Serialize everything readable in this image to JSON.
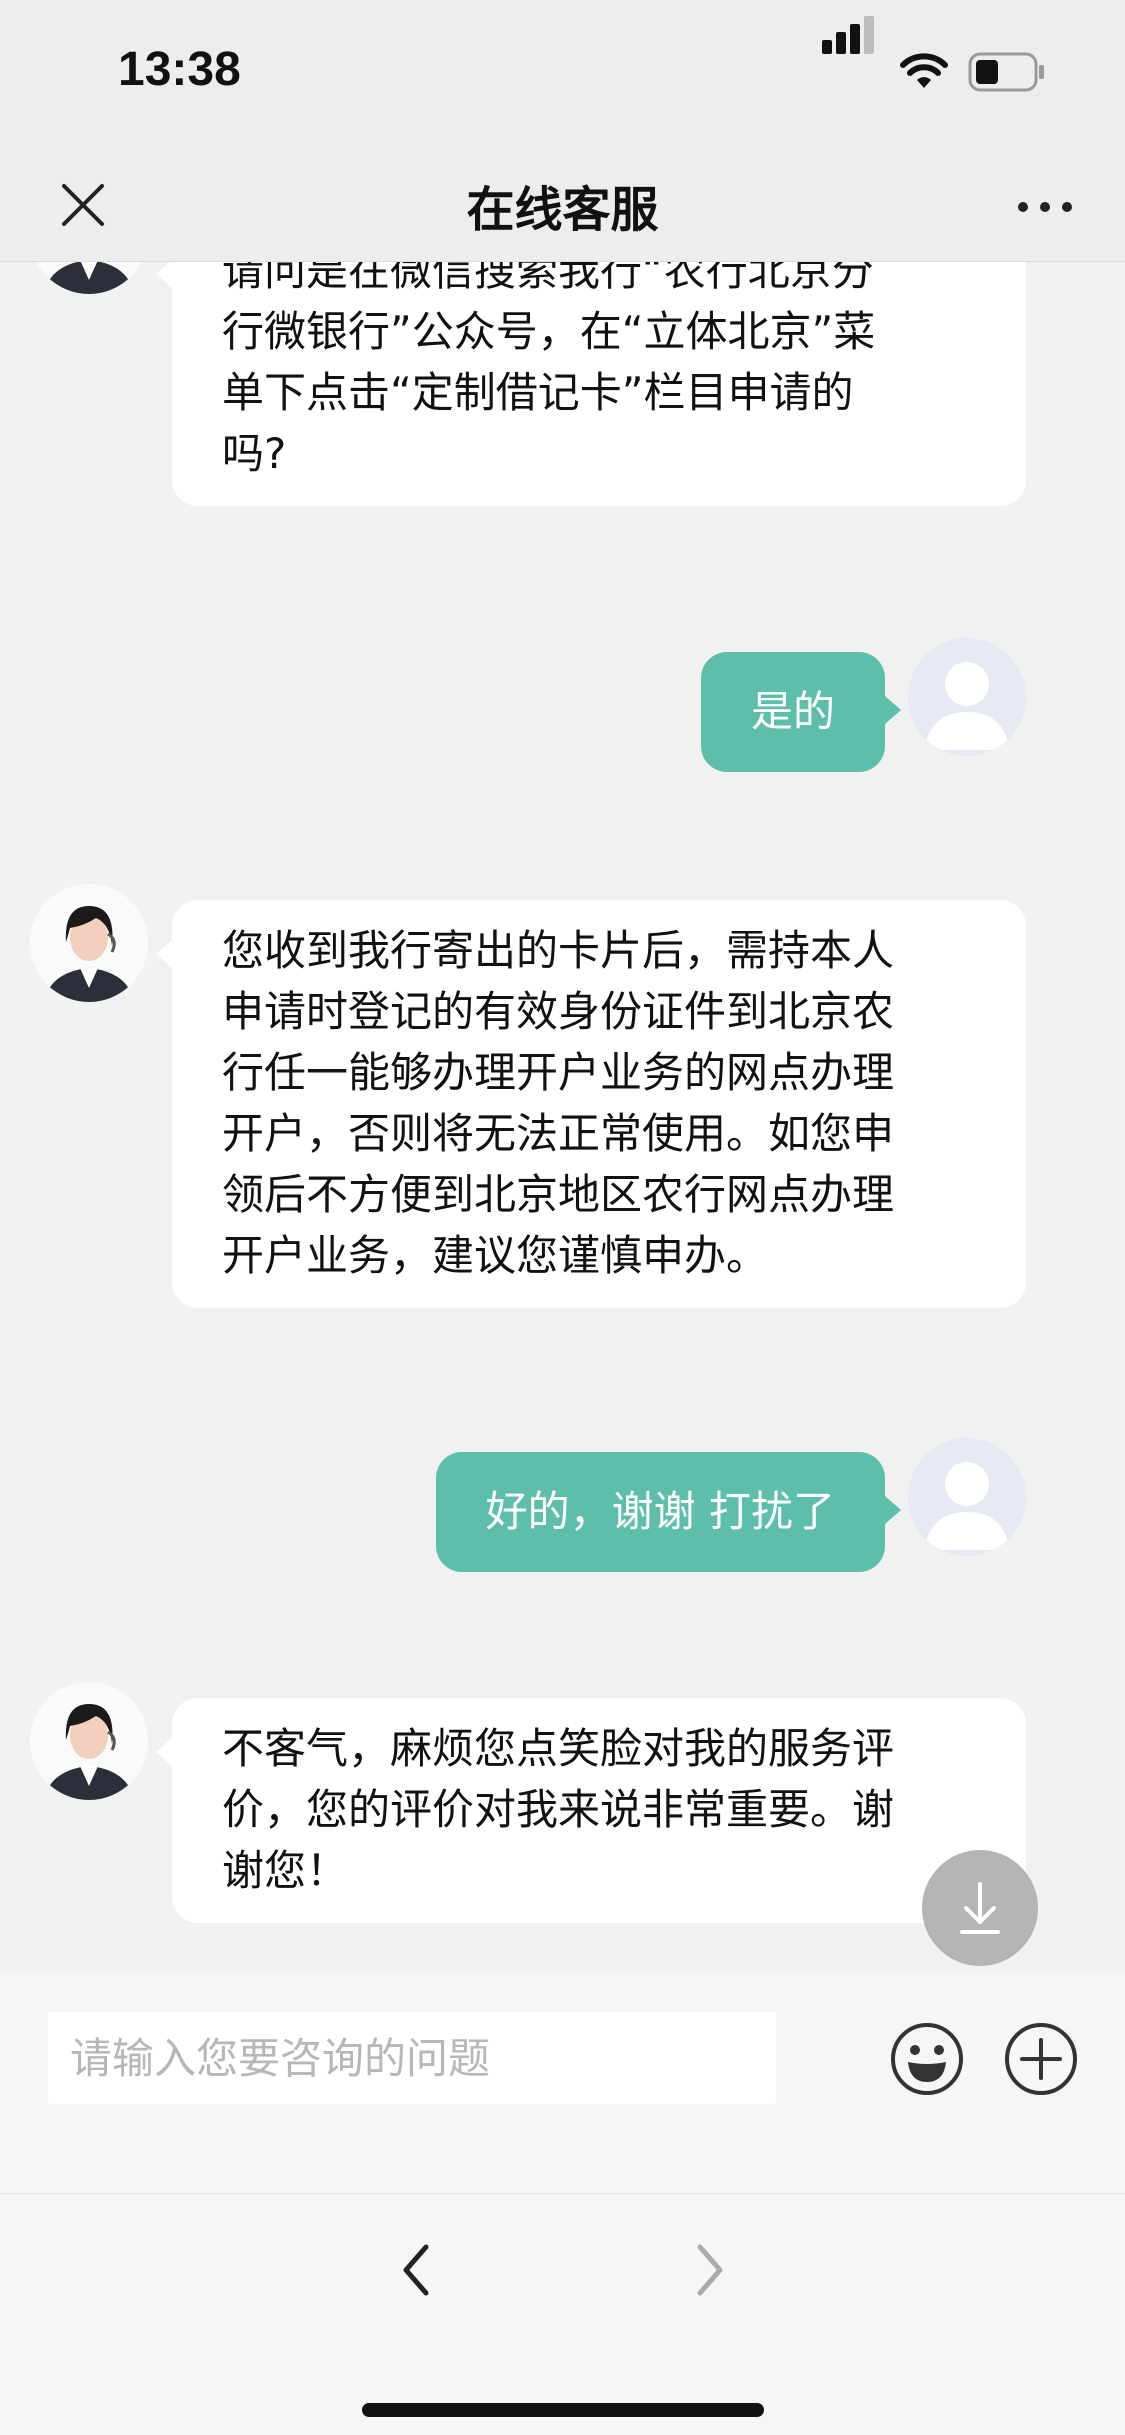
{
  "status_bar": {
    "time": "13:38",
    "icons": [
      "signal-icon",
      "wifi-icon",
      "battery-icon"
    ]
  },
  "nav": {
    "title": "在线客服",
    "left_icon": "close-icon",
    "right_icon": "more-icon"
  },
  "messages": [
    {
      "sender": "agent",
      "lines": [
        "请问是在微信搜索我行“农行北京分",
        "行微银行”公众号，在“立体北京”菜",
        "单下点击“定制借记卡”栏目申请的",
        "吗?"
      ]
    },
    {
      "sender": "user",
      "text": "是的"
    },
    {
      "sender": "agent",
      "lines": [
        "您收到我行寄出的卡片后，需持本人",
        "申请时登记的有效身份证件到北京农",
        "行任一能够办理开户业务的网点办理",
        "开户，否则将无法正常使用。如您申",
        "领后不方便到北京地区农行网点办理",
        "开户业务，建议您谨慎申办。"
      ]
    },
    {
      "sender": "user",
      "text": "好的，谢谢 打扰了"
    },
    {
      "sender": "agent",
      "lines": [
        "不客气，麻烦您点笑脸对我的服务评",
        "价，您的评价对我来说非常重要。谢",
        "谢您！"
      ]
    }
  ],
  "input": {
    "placeholder": "请输入您要咨询的问题",
    "value": ""
  },
  "input_icons": [
    "emoji-icon",
    "plus-icon"
  ],
  "bottom_nav": [
    "back-arrow-icon",
    "forward-arrow-icon"
  ],
  "colors": {
    "user_bubble": "#5dbfa9",
    "agent_bubble": "#ffffff",
    "background": "#f1f1f1"
  }
}
